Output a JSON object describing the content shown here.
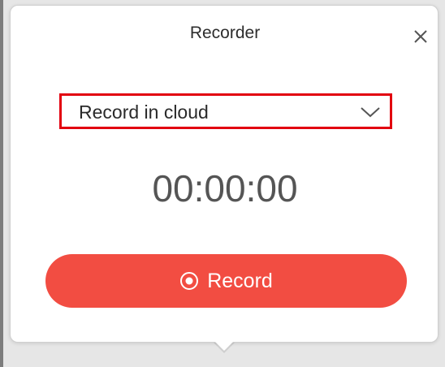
{
  "recorder": {
    "title": "Recorder",
    "storage_option": "Record in cloud",
    "timer": "00:00:00",
    "record_label": "Record"
  },
  "colors": {
    "highlight_border": "#e2000f",
    "record_button": "#f24d42",
    "timer_text": "#555555"
  },
  "icons": {
    "close": "close-icon",
    "dropdown": "chevron-down-icon",
    "record": "record-icon"
  }
}
